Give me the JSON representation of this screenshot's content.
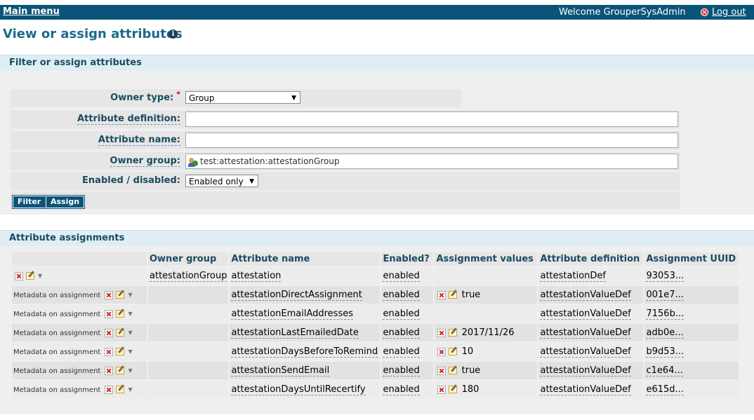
{
  "topbar": {
    "main_menu": "Main menu",
    "welcome": "Welcome GrouperSysAdmin",
    "logout": "Log out",
    "logout_icon": "logout-x-icon",
    "background": "#0b5479"
  },
  "page": {
    "title": "View or assign attributes",
    "info_icon": "i"
  },
  "filter": {
    "header": "Filter or assign attributes",
    "owner_type_label": "Owner type:",
    "owner_type_value": "Group",
    "attribute_definition_label": "Attribute definition:",
    "attribute_definition_value": "",
    "attribute_name_label": "Attribute name:",
    "attribute_name_value": "",
    "owner_group_label": "Owner group:",
    "owner_group_value": "test:attestation:attestationGroup",
    "enabled_label": "Enabled / disabled:",
    "enabled_value": "Enabled only",
    "filter_button": "Filter",
    "assign_button": "Assign"
  },
  "assignments": {
    "header": "Attribute assignments",
    "columns": [
      "",
      "Owner group",
      "Attribute name",
      "Enabled?",
      "Assignment values",
      "Attribute definition",
      "Assignment UUID"
    ],
    "rows": [
      {
        "actions": "",
        "owner_group": "attestationGroup",
        "attribute_name": "attestation",
        "enabled": "enabled",
        "value": "",
        "has_value_icons": false,
        "definition": "attestationDef",
        "uuid": "93053..."
      },
      {
        "actions": "Metadata on assignment",
        "owner_group": "",
        "attribute_name": "attestationDirectAssignment",
        "enabled": "enabled",
        "value": "true",
        "has_value_icons": true,
        "definition": "attestationValueDef",
        "uuid": "001e7..."
      },
      {
        "actions": "Metadata on assignment",
        "owner_group": "",
        "attribute_name": "attestationEmailAddresses",
        "enabled": "enabled",
        "value": "",
        "has_value_icons": false,
        "definition": "attestationValueDef",
        "uuid": "7156b..."
      },
      {
        "actions": "Metadata on assignment",
        "owner_group": "",
        "attribute_name": "attestationLastEmailedDate",
        "enabled": "enabled",
        "value": "2017/11/26",
        "has_value_icons": true,
        "definition": "attestationValueDef",
        "uuid": "adb0e..."
      },
      {
        "actions": "Metadata on assignment",
        "owner_group": "",
        "attribute_name": "attestationDaysBeforeToRemind",
        "enabled": "enabled",
        "value": "10",
        "has_value_icons": true,
        "definition": "attestationValueDef",
        "uuid": "b9d53..."
      },
      {
        "actions": "Metadata on assignment",
        "owner_group": "",
        "attribute_name": "attestationSendEmail",
        "enabled": "enabled",
        "value": "true",
        "has_value_icons": true,
        "definition": "attestationValueDef",
        "uuid": "c1e64..."
      },
      {
        "actions": "Metadata on assignment",
        "owner_group": "",
        "attribute_name": "attestationDaysUntilRecertify",
        "enabled": "enabled",
        "value": "180",
        "has_value_icons": true,
        "definition": "attestationValueDef",
        "uuid": "e615d..."
      }
    ]
  }
}
